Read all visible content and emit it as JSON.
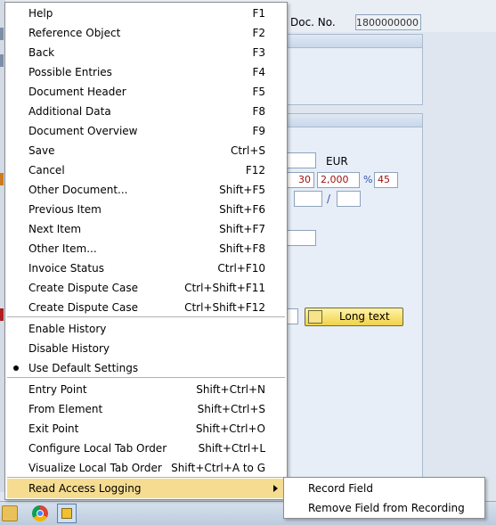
{
  "background": {
    "doc_no_label": "Doc. No.",
    "doc_no_value": "1800000000",
    "currency": "EUR",
    "field_30": "30",
    "field_2000": "2,000",
    "pct_symbol": "%",
    "field_45": "45",
    "slash": "/",
    "long_text_button": "Long text"
  },
  "menu": {
    "items": [
      {
        "label": "Help",
        "shortcut": "F1"
      },
      {
        "label": "Reference Object",
        "shortcut": "F2"
      },
      {
        "label": "Back",
        "shortcut": "F3"
      },
      {
        "label": "Possible Entries",
        "shortcut": "F4"
      },
      {
        "label": "Document Header",
        "shortcut": "F5"
      },
      {
        "label": "Additional Data",
        "shortcut": "F8"
      },
      {
        "label": "Document Overview",
        "shortcut": "F9"
      },
      {
        "label": "Save",
        "shortcut": "Ctrl+S"
      },
      {
        "label": "Cancel",
        "shortcut": "F12"
      },
      {
        "label": "Other Document...",
        "shortcut": "Shift+F5"
      },
      {
        "label": "Previous Item",
        "shortcut": "Shift+F6"
      },
      {
        "label": "Next Item",
        "shortcut": "Shift+F7"
      },
      {
        "label": "Other Item...",
        "shortcut": "Shift+F8"
      },
      {
        "label": "Invoice Status",
        "shortcut": "Ctrl+F10"
      },
      {
        "label": "Create Dispute Case",
        "shortcut": "Ctrl+Shift+F11"
      },
      {
        "label": "Create Dispute Case",
        "shortcut": "Ctrl+Shift+F12"
      },
      {
        "label": "Enable History",
        "shortcut": ""
      },
      {
        "label": "Disable History",
        "shortcut": ""
      },
      {
        "label": "Use Default Settings",
        "shortcut": ""
      },
      {
        "label": "Entry Point",
        "shortcut": "Shift+Ctrl+N"
      },
      {
        "label": "From Element",
        "shortcut": "Shift+Ctrl+S"
      },
      {
        "label": "Exit Point",
        "shortcut": "Shift+Ctrl+O"
      },
      {
        "label": "Configure Local Tab Order",
        "shortcut": "Shift+Ctrl+L"
      },
      {
        "label": "Visualize Local Tab Order",
        "shortcut": "Shift+Ctrl+A to G"
      },
      {
        "label": "Read Access Logging",
        "shortcut": ""
      }
    ]
  },
  "submenu": {
    "items": [
      {
        "label": "Record Field"
      },
      {
        "label": "Remove Field from Recording"
      }
    ]
  },
  "colors": {
    "highlight": "#f5dc90",
    "field_text": "#a01010"
  }
}
